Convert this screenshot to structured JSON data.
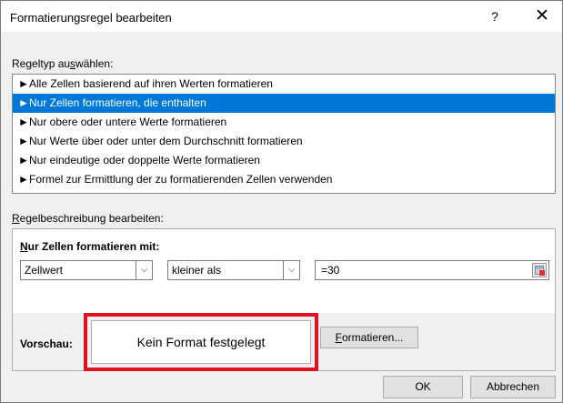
{
  "dialog": {
    "title": "Formatierungsregel bearbeiten",
    "help_label": "?",
    "close_label": "✕"
  },
  "rule_type": {
    "label_pre": "Regeltyp au",
    "label_u": "s",
    "label_post": "wählen:",
    "items": [
      {
        "label": "Alle Zellen basierend auf ihren Werten formatieren",
        "selected": false
      },
      {
        "label": "Nur Zellen formatieren, die enthalten",
        "selected": true
      },
      {
        "label": "Nur obere oder untere Werte formatieren",
        "selected": false
      },
      {
        "label": "Nur Werte über oder unter dem Durchschnitt formatieren",
        "selected": false
      },
      {
        "label": "Nur eindeutige oder doppelte Werte formatieren",
        "selected": false
      },
      {
        "label": "Formel zur Ermittlung der zu formatierenden Zellen verwenden",
        "selected": false
      }
    ],
    "bullet": "►"
  },
  "rule_desc": {
    "label_u": "R",
    "label_post": "egelbeschreibung bearbeiten:",
    "heading_u": "N",
    "heading_post": "ur Zellen formatieren mit:",
    "condition_field": "Zellwert",
    "operator": "kleiner als",
    "value": "=30",
    "dropdown_glyph": "⌵",
    "preview_label": "Vorschau:",
    "preview_text": "Kein Format festgelegt",
    "format_button_u": "F",
    "format_button_post": "ormatieren..."
  },
  "buttons": {
    "ok": "OK",
    "cancel": "Abbrechen"
  },
  "colors": {
    "selection": "#0078d7",
    "highlight_border": "#e0121e"
  }
}
